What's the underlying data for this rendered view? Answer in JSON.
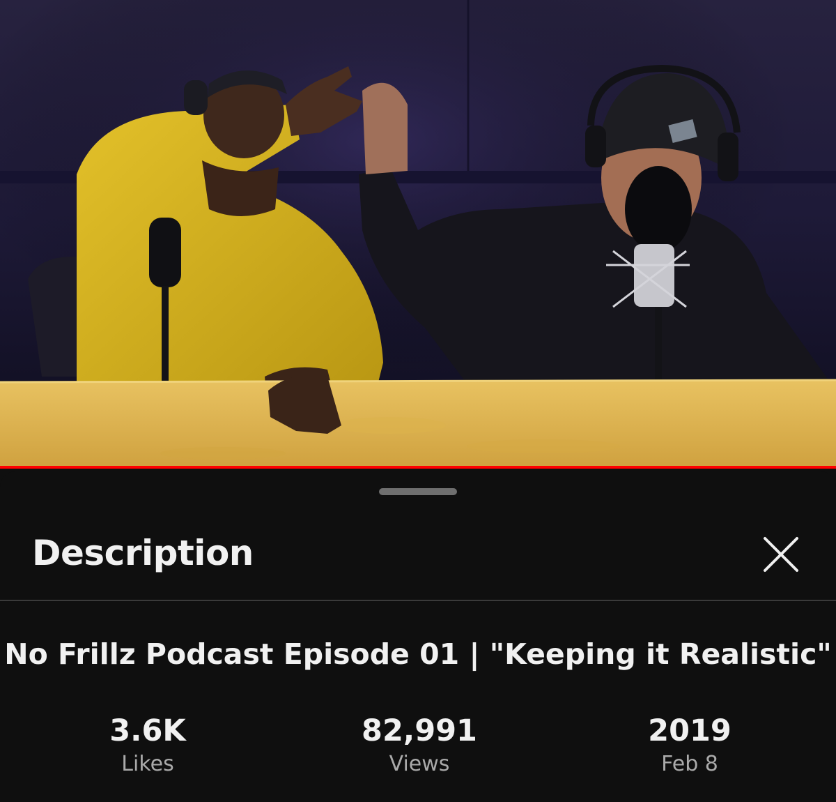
{
  "video": {
    "thumbnail_alt": "Two podcast hosts with headphones at a wooden table with microphones",
    "progress": 1.0,
    "progress_color": "#ff0000"
  },
  "sheet": {
    "title": "Description",
    "close_icon": "close-icon"
  },
  "video_title": "No Frillz Podcast Episode 01 | \"Keeping it Realistic\"",
  "stats": [
    {
      "value": "3.6K",
      "label": "Likes"
    },
    {
      "value": "82,991",
      "label": "Views"
    },
    {
      "value": "2019",
      "label": "Feb 8"
    }
  ],
  "colors": {
    "background": "#0f0f0f",
    "text_primary": "#f1f1f1",
    "text_secondary": "#aaaaaa"
  }
}
